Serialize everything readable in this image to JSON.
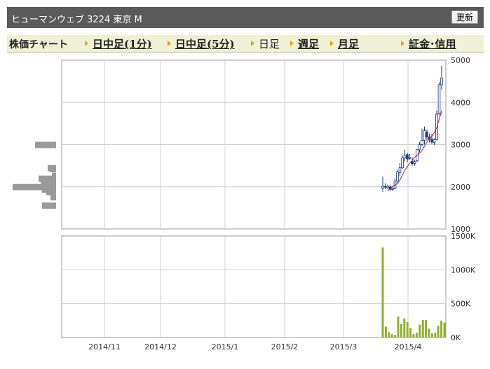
{
  "header": {
    "title": "ヒューマンウェブ 3224 東京 M",
    "refresh_label": "更新"
  },
  "tabs": [
    {
      "label": "株価チャート",
      "type": "current"
    },
    {
      "label": "日中足(1分)",
      "type": "link"
    },
    {
      "label": "日中足(5分)",
      "type": "link"
    },
    {
      "label": "日足",
      "type": "plain"
    },
    {
      "label": "週足",
      "type": "link"
    },
    {
      "label": "月足",
      "type": "link"
    },
    {
      "label": "証金･信用",
      "type": "link"
    }
  ],
  "chart_data": {
    "type": "candlestick",
    "price_axis": {
      "ylim": [
        1000,
        5000
      ],
      "ticks": [
        "5000",
        "4000",
        "3000",
        "2000",
        "1000"
      ]
    },
    "volume_axis": {
      "ylim": [
        0,
        1500000
      ],
      "ticks": [
        "1500K",
        "1000K",
        "500K",
        "0K"
      ]
    },
    "x_labels": [
      "2014/11",
      "2014/12",
      "2015/1",
      "2015/2",
      "2015/3",
      "2015/4"
    ],
    "volume_profile": [
      {
        "price": 3000,
        "length": 30
      },
      {
        "price": 2450,
        "length": 12
      },
      {
        "price": 2430,
        "length": 9
      },
      {
        "price": 2270,
        "length": 6
      },
      {
        "price": 2200,
        "length": 25
      },
      {
        "price": 2140,
        "length": 8
      },
      {
        "price": 2080,
        "length": 22
      },
      {
        "price": 2000,
        "length": 62
      },
      {
        "price": 1940,
        "length": 20
      },
      {
        "price": 1880,
        "length": 14
      },
      {
        "price": 1760,
        "length": 8
      },
      {
        "price": 1560,
        "length": 20
      }
    ],
    "candles": [
      {
        "o": 1960,
        "h": 2240,
        "l": 1880,
        "c": 2010
      },
      {
        "o": 2010,
        "h": 2080,
        "l": 1940,
        "c": 1990
      },
      {
        "o": 1980,
        "h": 2050,
        "l": 1940,
        "c": 2010
      },
      {
        "o": 2000,
        "h": 2040,
        "l": 1900,
        "c": 1940
      },
      {
        "o": 1940,
        "h": 1990,
        "l": 1900,
        "c": 1960
      },
      {
        "o": 1960,
        "h": 2200,
        "l": 1940,
        "c": 2140
      },
      {
        "o": 2140,
        "h": 2400,
        "l": 2100,
        "c": 2350
      },
      {
        "o": 2340,
        "h": 2560,
        "l": 2250,
        "c": 2450
      },
      {
        "o": 2450,
        "h": 2750,
        "l": 2420,
        "c": 2680
      },
      {
        "o": 2680,
        "h": 2880,
        "l": 2600,
        "c": 2750
      },
      {
        "o": 2760,
        "h": 2800,
        "l": 2580,
        "c": 2660
      },
      {
        "o": 2670,
        "h": 2780,
        "l": 2640,
        "c": 2700
      },
      {
        "o": 2600,
        "h": 2700,
        "l": 2500,
        "c": 2550
      },
      {
        "o": 2550,
        "h": 2640,
        "l": 2500,
        "c": 2600
      },
      {
        "o": 2620,
        "h": 2900,
        "l": 2580,
        "c": 2880
      },
      {
        "o": 2880,
        "h": 3060,
        "l": 2820,
        "c": 3000
      },
      {
        "o": 3000,
        "h": 3380,
        "l": 2960,
        "c": 3100
      },
      {
        "o": 3100,
        "h": 3430,
        "l": 3000,
        "c": 3330
      },
      {
        "o": 3300,
        "h": 3360,
        "l": 3100,
        "c": 3180
      },
      {
        "o": 3180,
        "h": 3260,
        "l": 3050,
        "c": 3130
      },
      {
        "o": 3130,
        "h": 3260,
        "l": 3010,
        "c": 3060
      },
      {
        "o": 3050,
        "h": 3150,
        "l": 2990,
        "c": 3120
      },
      {
        "o": 3120,
        "h": 3800,
        "l": 3100,
        "c": 3720
      },
      {
        "o": 3730,
        "h": 4480,
        "l": 3700,
        "c": 4420
      },
      {
        "o": 4420,
        "h": 4870,
        "l": 4300,
        "c": 4580
      }
    ],
    "moving_average": [
      1900,
      1960,
      2010,
      2040,
      2080,
      2160,
      2280,
      2400,
      2470,
      2560,
      2620,
      2700,
      2740,
      2800,
      2860,
      2960,
      3060,
      3140,
      3200,
      3280,
      3400,
      3600,
      3800
    ],
    "volume": [
      1330000,
      160000,
      80000,
      50000,
      40000,
      310000,
      200000,
      280000,
      230000,
      140000,
      50000,
      70000,
      190000,
      260000,
      260000,
      130000,
      60000,
      70000,
      170000,
      250000,
      220000
    ]
  }
}
